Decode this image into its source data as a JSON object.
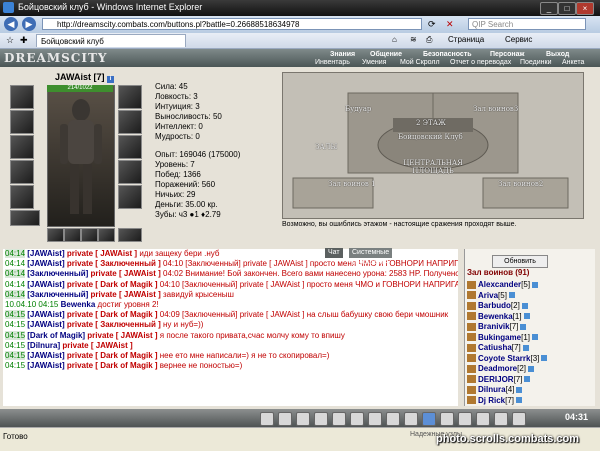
{
  "browser": {
    "title": "Бойцовский клуб - Windows Internet Explorer",
    "url": "http://dreamscity.combats.com/buttons.pl?battle=0.26688518634978",
    "search_placeholder": "QIP Search",
    "tab_title": "Бойцовский клуб",
    "toolbar_page": "Страница",
    "toolbar_service": "Сервис"
  },
  "game_menu": {
    "logo": "DREAMSCITY",
    "top": [
      "Знания",
      "Общение",
      "Безопасность",
      "Персонаж",
      "Выход"
    ],
    "bottom": [
      "Инвентарь",
      "Умения",
      "Мой Скролл",
      "Отчет о переводах",
      "Поединки",
      "Анкета"
    ]
  },
  "character": {
    "name": "JAWAist",
    "level": "[7]",
    "hp": "214/1022",
    "stats": [
      "Сила: 45",
      "Ловкость: 3",
      "Интуиция: 3",
      "Выносливость: 50",
      "Интеллект: 0",
      "Мудрость: 0"
    ],
    "info": [
      "Опыт: 169046 (175000)",
      "Уровень: 7",
      "Побед: 1366",
      "Поражений: 560",
      "Ничьих: 29",
      "Деньги: 35.00 кр.",
      "Зубы: ч3 ●1 ♦2.79"
    ]
  },
  "map": {
    "labels": [
      "Будуар",
      "Зал воинов3",
      "2 ЭТАЖ",
      "Бойцовский Клуб",
      "ЗАЛЫ",
      "ЦЕНТРАЛЬНАЯ ПЛОЩАДЬ",
      "Зал воинов 1",
      "Зал воинов2"
    ],
    "note": "Возможно, вы ошиблись этажом - настоящие сражения проходят выше."
  },
  "chat_tabs": [
    "Чат",
    "Системные сообщения"
  ],
  "chat_lines": [
    [
      "04:14",
      "[JAWAist]",
      "private [ JAWAist ]",
      "иди защеку бери .нуб"
    ],
    [
      "04:14",
      "[JAWAist]",
      "private [ Заключенный ]",
      "04:10 [Заключенный] private [ JAWAist ] просто меня ЧМО и ГОВНОРИ НАПРИГАЮТ"
    ],
    [
      "04:14",
      "[Заключенный]",
      "private [ JAWAist ]",
      "04:02 Внимание! Бой закончен. Всего вами нанесено урона: 2583 HP. Получено опыта: 1345 (105%). Вы получили 1.1.00 за этот бой."
    ],
    [
      "04:14",
      "[JAWAist]",
      "private [ Dark of Magik ]",
      "04:10 [Заключенный] private [ JAWAist ] просто меня ЧМО и ГОВНОРИ НАПРИГАЮТ"
    ],
    [
      "04:14",
      "[Заключенный]",
      "private [ JAWAist ]",
      "завидуй крысеныш"
    ],
    [
      "10.04.10 04:15",
      "Bewenka",
      "",
      "достиг уровня 2!"
    ],
    [
      "04:15",
      "[JAWAist]",
      "private [ Dark of Magik ]",
      "04:09 [Заключенный] private [ JAWAist ] на слыш бабушку свою бери чмошник"
    ],
    [
      "04:15",
      "[JAWAist]",
      "private [ Заключенный ]",
      "ну и нуб=))"
    ],
    [
      "04:15",
      "[Dark of Magik]",
      "private [ JAWAist ]",
      "я после такого привата,счас молчу кому то впишу"
    ],
    [
      "04:15",
      "[Dilnura]",
      "private [ JAWAist ]",
      ""
    ],
    [
      "04:15",
      "[JAWAist]",
      "private [ Dark of Magik ]",
      "нее ето мне написали=) я не то скопировал=)"
    ],
    [
      "04:15",
      "[JAWAist]",
      "private [ Dark of Magik ]",
      "вернее не поностью=)"
    ]
  ],
  "players": {
    "refresh_label": "Обновить",
    "title": "Зал воинов (91)",
    "list": [
      {
        "name": "Alexcander",
        "level": "[5]"
      },
      {
        "name": "Ariva",
        "level": "[5]"
      },
      {
        "name": "Barbudo",
        "level": "[2]"
      },
      {
        "name": "Bewenka",
        "level": "[1]"
      },
      {
        "name": "Branivik",
        "level": "[7]"
      },
      {
        "name": "Bukingame",
        "level": "[1]"
      },
      {
        "name": "Catiusha",
        "level": "[7]"
      },
      {
        "name": "Coyote Starrk",
        "level": "[3]"
      },
      {
        "name": "Deadmore",
        "level": "[2]"
      },
      {
        "name": "DERIJOR",
        "level": "[7]"
      },
      {
        "name": "Dilnura",
        "level": "[4]"
      },
      {
        "name": "Dj Rick",
        "level": "[7]"
      }
    ]
  },
  "clock": "04:31",
  "status_text": "Готово",
  "zone_text": "Надежные узлы",
  "watermark": "photo.scrolls.combats.com"
}
